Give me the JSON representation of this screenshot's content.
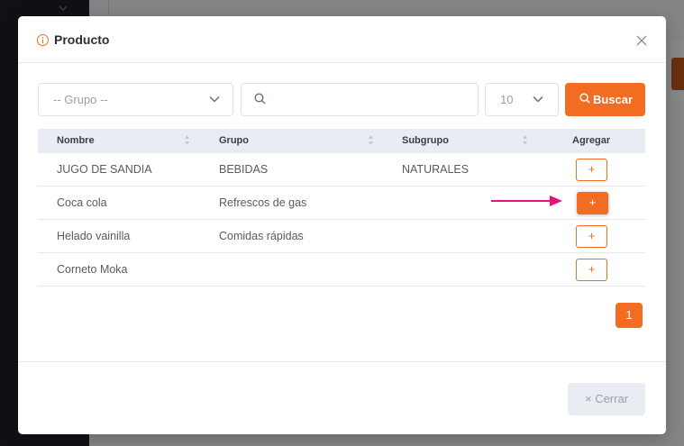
{
  "modal": {
    "title": "Producto",
    "filters": {
      "grupo_placeholder": "-- Grupo --",
      "search_value": "",
      "page_size": "10",
      "search_button": "Buscar"
    },
    "table": {
      "columns": [
        "Nombre",
        "Grupo",
        "Subgrupo",
        "Agregar"
      ],
      "rows": [
        {
          "nombre": "JUGO DE SANDIA",
          "grupo": "BEBIDAS",
          "subgrupo": "NATURALES",
          "add": "+"
        },
        {
          "nombre": "Coca cola",
          "grupo": "Refrescos de gas",
          "subgrupo": "",
          "add": "+"
        },
        {
          "nombre": "Helado vainilla",
          "grupo": "Comidas rápidas",
          "subgrupo": "",
          "add": "+"
        },
        {
          "nombre": "Corneto Moka",
          "grupo": "",
          "subgrupo": "",
          "add": "+"
        }
      ]
    },
    "pagination": {
      "current_page": "1"
    },
    "footer": {
      "close_label": "Cerrar",
      "close_glyph": "×"
    }
  },
  "colors": {
    "accent": "#f26c21",
    "annotation_arrow": "#e8107a"
  }
}
